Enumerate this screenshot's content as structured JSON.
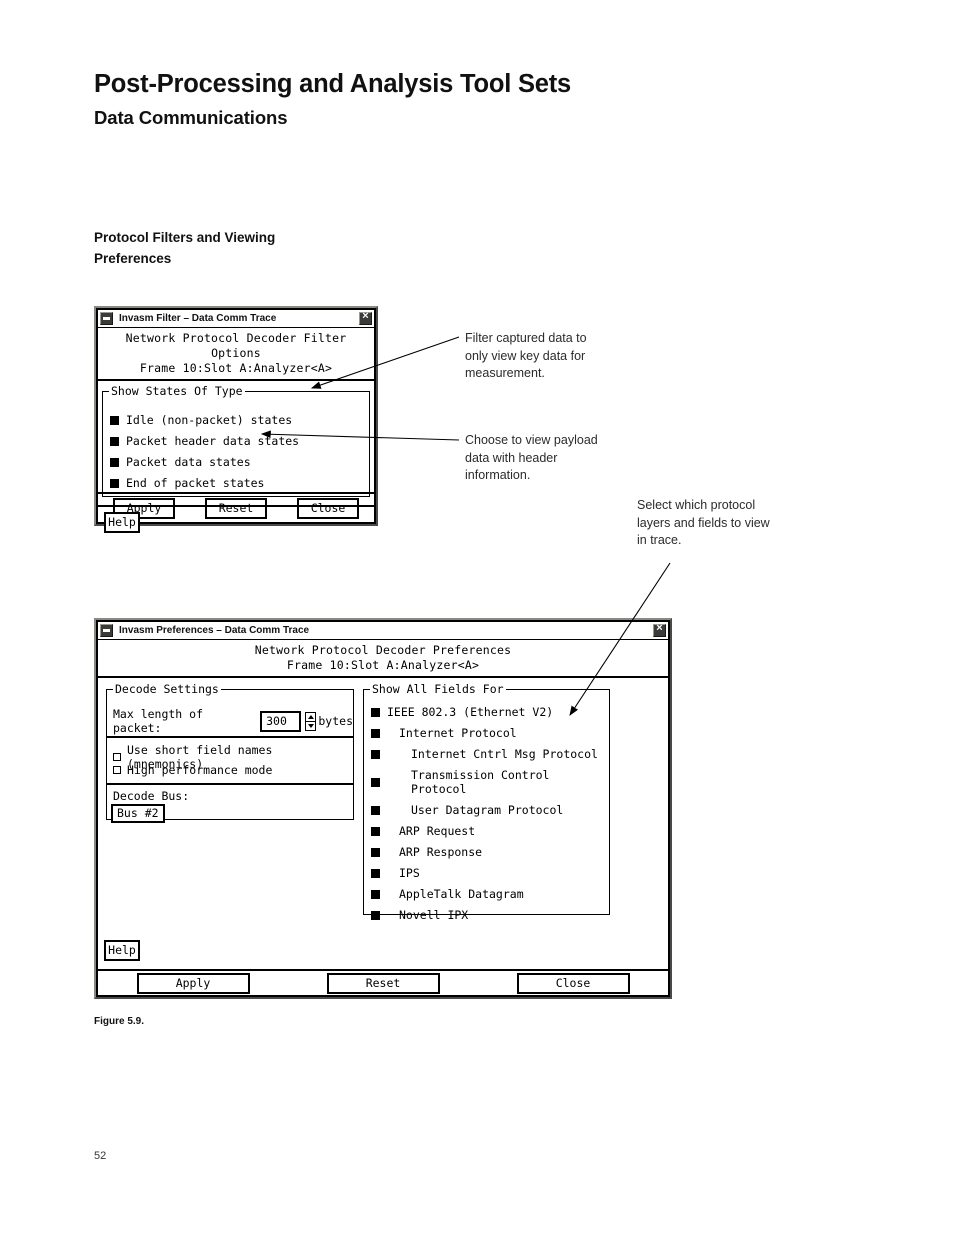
{
  "document": {
    "title": "Post-Processing and Analysis Tool Sets",
    "subtitle": "Data Communications",
    "section_heading_line1": "Protocol Filters and Viewing",
    "section_heading_line2": "Preferences",
    "figure_caption": "Figure 5.9.",
    "page_number": "52"
  },
  "callouts": {
    "filter": "Filter captured data to only view key data for measurement.",
    "payload": "Choose to view payload data with header information.",
    "layers": "Select which protocol layers and fields to view in trace."
  },
  "filter_dialog": {
    "titlebar": {
      "title": "Invasm Filter – Data Comm Trace",
      "minimize_icon": "minimize-icon",
      "close_icon": "close-icon"
    },
    "header_line1": "Network Protocol Decoder Filter Options",
    "header_line2": "Frame 10:Slot A:Analyzer<A>",
    "group_title": "Show States Of Type",
    "options": [
      {
        "label": "Idle (non-packet) states",
        "checked": true
      },
      {
        "label": "Packet header data states",
        "checked": true
      },
      {
        "label": "Packet data states",
        "checked": true
      },
      {
        "label": "End of packet states",
        "checked": true
      }
    ],
    "help_label": "Help",
    "buttons": {
      "apply": "Apply",
      "reset": "Reset",
      "close": "Close"
    }
  },
  "preferences_dialog": {
    "titlebar": {
      "title": "Invasm Preferences – Data Comm Trace",
      "minimize_icon": "minimize-icon",
      "close_icon": "close-icon"
    },
    "header_line1": "Network Protocol Decoder Preferences",
    "header_line2": "Frame 10:Slot A:Analyzer<A>",
    "decode_settings": {
      "group_title": "Decode Settings",
      "max_length_label": "Max length of packet:",
      "max_length_value": "300",
      "units_label": "bytes",
      "checkboxes": [
        {
          "label": "Use short field names (mnemonics)",
          "checked": false
        },
        {
          "label": "High performance mode",
          "checked": false
        }
      ],
      "decode_bus_label": "Decode Bus:",
      "decode_bus_value": "Bus #2"
    },
    "show_all_fields": {
      "group_title": "Show All Fields For",
      "items": [
        {
          "label": "IEEE 802.3 (Ethernet V2)",
          "indent": 0,
          "checked": true
        },
        {
          "label": "Internet Protocol",
          "indent": 1,
          "checked": true
        },
        {
          "label": "Internet Cntrl Msg Protocol",
          "indent": 2,
          "checked": true
        },
        {
          "label": "Transmission Control Protocol",
          "indent": 2,
          "checked": true
        },
        {
          "label": "User Datagram Protocol",
          "indent": 2,
          "checked": true
        },
        {
          "label": "ARP Request",
          "indent": 1,
          "checked": true
        },
        {
          "label": "ARP Response",
          "indent": 1,
          "checked": true
        },
        {
          "label": "IPS",
          "indent": 1,
          "checked": true
        },
        {
          "label": "AppleTalk Datagram",
          "indent": 1,
          "checked": true
        },
        {
          "label": "Novell IPX",
          "indent": 1,
          "checked": true
        }
      ]
    },
    "help_label": "Help",
    "buttons": {
      "apply": "Apply",
      "reset": "Reset",
      "close": "Close"
    }
  }
}
